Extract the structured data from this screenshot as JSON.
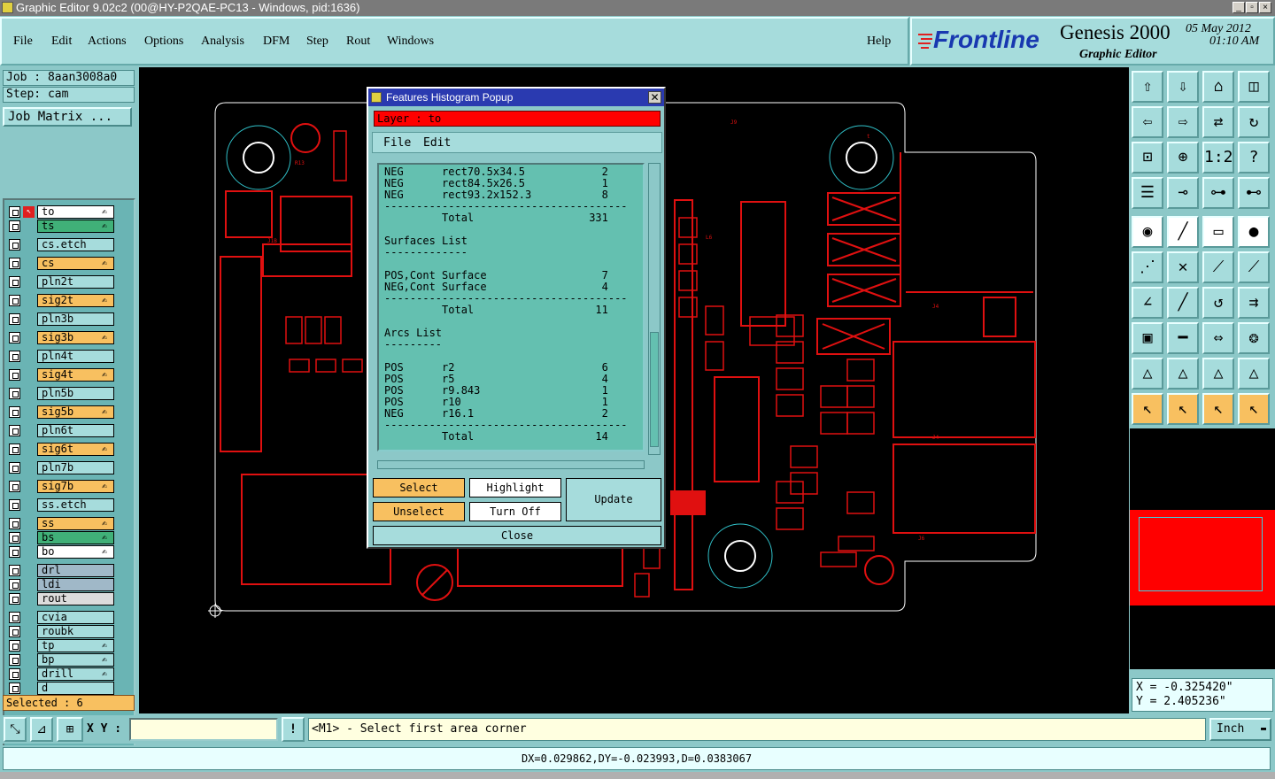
{
  "window": {
    "title": "Graphic Editor 9.02c2 (00@HY-P2QAE-PC13 - Windows, pid:1636)"
  },
  "menu": {
    "file": "File",
    "edit": "Edit",
    "actions": "Actions",
    "options": "Options",
    "analysis": "Analysis",
    "dfm": "DFM",
    "step": "Step",
    "rout": "Rout",
    "windows": "Windows",
    "help": "Help"
  },
  "brand": {
    "logo": "Frontline",
    "product": "Genesis 2000",
    "subtitle": "Graphic Editor",
    "date": "05 May 2012",
    "time": "01:10 AM"
  },
  "job": {
    "job": "Job : 8aan3008a0",
    "step": "Step: cam",
    "matrix": "Job Matrix ..."
  },
  "layers": [
    {
      "name": "to",
      "color": "#ffffff",
      "hand": true
    },
    {
      "name": "ts",
      "color": "#40b078",
      "hand": true
    },
    {
      "name": "cs.etch",
      "color": "#a6dcdc",
      "hand": false
    },
    {
      "name": "cs",
      "color": "#f8c060",
      "hand": true
    },
    {
      "name": "pln2t",
      "color": "#a6dcdc",
      "hand": false
    },
    {
      "name": "sig2t",
      "color": "#f8c060",
      "hand": true
    },
    {
      "name": "pln3b",
      "color": "#a6dcdc",
      "hand": false
    },
    {
      "name": "sig3b",
      "color": "#f8c060",
      "hand": true
    },
    {
      "name": "pln4t",
      "color": "#a6dcdc",
      "hand": false
    },
    {
      "name": "sig4t",
      "color": "#f8c060",
      "hand": true
    },
    {
      "name": "pln5b",
      "color": "#a6dcdc",
      "hand": false
    },
    {
      "name": "sig5b",
      "color": "#f8c060",
      "hand": true
    },
    {
      "name": "pln6t",
      "color": "#a6dcdc",
      "hand": false
    },
    {
      "name": "sig6t",
      "color": "#f8c060",
      "hand": true
    },
    {
      "name": "pln7b",
      "color": "#a6dcdc",
      "hand": false
    },
    {
      "name": "sig7b",
      "color": "#f8c060",
      "hand": true
    },
    {
      "name": "ss.etch",
      "color": "#a6dcdc",
      "hand": false
    },
    {
      "name": "ss",
      "color": "#f8c060",
      "hand": true
    },
    {
      "name": "bs",
      "color": "#40b078",
      "hand": true
    },
    {
      "name": "bo",
      "color": "#ffffff",
      "hand": true
    },
    {
      "name": "drl",
      "color": "#a0b8c8",
      "hand": false
    },
    {
      "name": "ldi",
      "color": "#a0b8c8",
      "hand": false
    },
    {
      "name": "rout",
      "color": "#dcdcdc",
      "hand": false
    },
    {
      "name": "cvia",
      "color": "#a6dcdc",
      "hand": false
    },
    {
      "name": "roubk",
      "color": "#a6dcdc",
      "hand": false
    },
    {
      "name": "tp",
      "color": "#a6dcdc",
      "hand": true
    },
    {
      "name": "bp",
      "color": "#a6dcdc",
      "hand": true
    },
    {
      "name": "drill",
      "color": "#a6dcdc",
      "hand": true
    },
    {
      "name": "d",
      "color": "#a6dcdc",
      "hand": false
    }
  ],
  "selected": "Selected : 6",
  "popup": {
    "title": "Features Histogram Popup",
    "layer": "Layer :  to",
    "menu_file": "File",
    "menu_edit": "Edit",
    "lines": [
      "NEG      rect70.5x34.5            2",
      "NEG      rect84.5x26.5            1",
      "NEG      rect93.2x152.3           8",
      "--------------------------------------",
      "         Total                  331",
      "",
      "Surfaces List",
      "-------------",
      "",
      "POS,Cont Surface                  7",
      "NEG,Cont Surface                  4",
      "--------------------------------------",
      "         Total                   11",
      "",
      "Arcs List",
      "---------",
      "",
      "POS      r2                       6",
      "POS      r5                       4",
      "POS      r9.843                   1",
      "POS      r10                      1",
      "NEG      r16.1                    2",
      "--------------------------------------",
      "         Total                   14"
    ],
    "select": "Select",
    "unselect": "Unselect",
    "highlight": "Highlight",
    "turn_off": "Turn Off",
    "update": "Update",
    "close": "Close"
  },
  "coords": {
    "x": "X = -0.325420\"",
    "y": "Y = 2.405236\""
  },
  "status": {
    "xy_label": "X Y :",
    "xy_value": "",
    "message": "<M1> - Select first area corner",
    "units": "Inch",
    "measure": "DX=0.029862,DY=-0.023993,D=0.0383067"
  }
}
